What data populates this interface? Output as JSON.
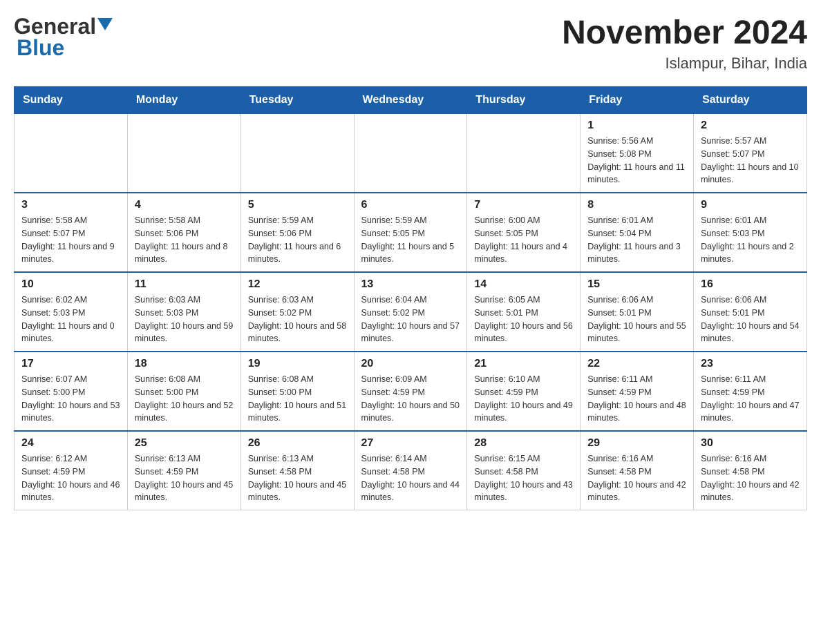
{
  "header": {
    "logo": {
      "general": "General",
      "blue": "Blue",
      "alt": "GeneralBlue logo"
    },
    "month_title": "November 2024",
    "location": "Islampur, Bihar, India"
  },
  "days_of_week": [
    "Sunday",
    "Monday",
    "Tuesday",
    "Wednesday",
    "Thursday",
    "Friday",
    "Saturday"
  ],
  "weeks": [
    {
      "days": [
        {
          "number": "",
          "info": ""
        },
        {
          "number": "",
          "info": ""
        },
        {
          "number": "",
          "info": ""
        },
        {
          "number": "",
          "info": ""
        },
        {
          "number": "",
          "info": ""
        },
        {
          "number": "1",
          "info": "Sunrise: 5:56 AM\nSunset: 5:08 PM\nDaylight: 11 hours and 11 minutes."
        },
        {
          "number": "2",
          "info": "Sunrise: 5:57 AM\nSunset: 5:07 PM\nDaylight: 11 hours and 10 minutes."
        }
      ]
    },
    {
      "days": [
        {
          "number": "3",
          "info": "Sunrise: 5:58 AM\nSunset: 5:07 PM\nDaylight: 11 hours and 9 minutes."
        },
        {
          "number": "4",
          "info": "Sunrise: 5:58 AM\nSunset: 5:06 PM\nDaylight: 11 hours and 8 minutes."
        },
        {
          "number": "5",
          "info": "Sunrise: 5:59 AM\nSunset: 5:06 PM\nDaylight: 11 hours and 6 minutes."
        },
        {
          "number": "6",
          "info": "Sunrise: 5:59 AM\nSunset: 5:05 PM\nDaylight: 11 hours and 5 minutes."
        },
        {
          "number": "7",
          "info": "Sunrise: 6:00 AM\nSunset: 5:05 PM\nDaylight: 11 hours and 4 minutes."
        },
        {
          "number": "8",
          "info": "Sunrise: 6:01 AM\nSunset: 5:04 PM\nDaylight: 11 hours and 3 minutes."
        },
        {
          "number": "9",
          "info": "Sunrise: 6:01 AM\nSunset: 5:03 PM\nDaylight: 11 hours and 2 minutes."
        }
      ]
    },
    {
      "days": [
        {
          "number": "10",
          "info": "Sunrise: 6:02 AM\nSunset: 5:03 PM\nDaylight: 11 hours and 0 minutes."
        },
        {
          "number": "11",
          "info": "Sunrise: 6:03 AM\nSunset: 5:03 PM\nDaylight: 10 hours and 59 minutes."
        },
        {
          "number": "12",
          "info": "Sunrise: 6:03 AM\nSunset: 5:02 PM\nDaylight: 10 hours and 58 minutes."
        },
        {
          "number": "13",
          "info": "Sunrise: 6:04 AM\nSunset: 5:02 PM\nDaylight: 10 hours and 57 minutes."
        },
        {
          "number": "14",
          "info": "Sunrise: 6:05 AM\nSunset: 5:01 PM\nDaylight: 10 hours and 56 minutes."
        },
        {
          "number": "15",
          "info": "Sunrise: 6:06 AM\nSunset: 5:01 PM\nDaylight: 10 hours and 55 minutes."
        },
        {
          "number": "16",
          "info": "Sunrise: 6:06 AM\nSunset: 5:01 PM\nDaylight: 10 hours and 54 minutes."
        }
      ]
    },
    {
      "days": [
        {
          "number": "17",
          "info": "Sunrise: 6:07 AM\nSunset: 5:00 PM\nDaylight: 10 hours and 53 minutes."
        },
        {
          "number": "18",
          "info": "Sunrise: 6:08 AM\nSunset: 5:00 PM\nDaylight: 10 hours and 52 minutes."
        },
        {
          "number": "19",
          "info": "Sunrise: 6:08 AM\nSunset: 5:00 PM\nDaylight: 10 hours and 51 minutes."
        },
        {
          "number": "20",
          "info": "Sunrise: 6:09 AM\nSunset: 4:59 PM\nDaylight: 10 hours and 50 minutes."
        },
        {
          "number": "21",
          "info": "Sunrise: 6:10 AM\nSunset: 4:59 PM\nDaylight: 10 hours and 49 minutes."
        },
        {
          "number": "22",
          "info": "Sunrise: 6:11 AM\nSunset: 4:59 PM\nDaylight: 10 hours and 48 minutes."
        },
        {
          "number": "23",
          "info": "Sunrise: 6:11 AM\nSunset: 4:59 PM\nDaylight: 10 hours and 47 minutes."
        }
      ]
    },
    {
      "days": [
        {
          "number": "24",
          "info": "Sunrise: 6:12 AM\nSunset: 4:59 PM\nDaylight: 10 hours and 46 minutes."
        },
        {
          "number": "25",
          "info": "Sunrise: 6:13 AM\nSunset: 4:59 PM\nDaylight: 10 hours and 45 minutes."
        },
        {
          "number": "26",
          "info": "Sunrise: 6:13 AM\nSunset: 4:58 PM\nDaylight: 10 hours and 45 minutes."
        },
        {
          "number": "27",
          "info": "Sunrise: 6:14 AM\nSunset: 4:58 PM\nDaylight: 10 hours and 44 minutes."
        },
        {
          "number": "28",
          "info": "Sunrise: 6:15 AM\nSunset: 4:58 PM\nDaylight: 10 hours and 43 minutes."
        },
        {
          "number": "29",
          "info": "Sunrise: 6:16 AM\nSunset: 4:58 PM\nDaylight: 10 hours and 42 minutes."
        },
        {
          "number": "30",
          "info": "Sunrise: 6:16 AM\nSunset: 4:58 PM\nDaylight: 10 hours and 42 minutes."
        }
      ]
    }
  ]
}
